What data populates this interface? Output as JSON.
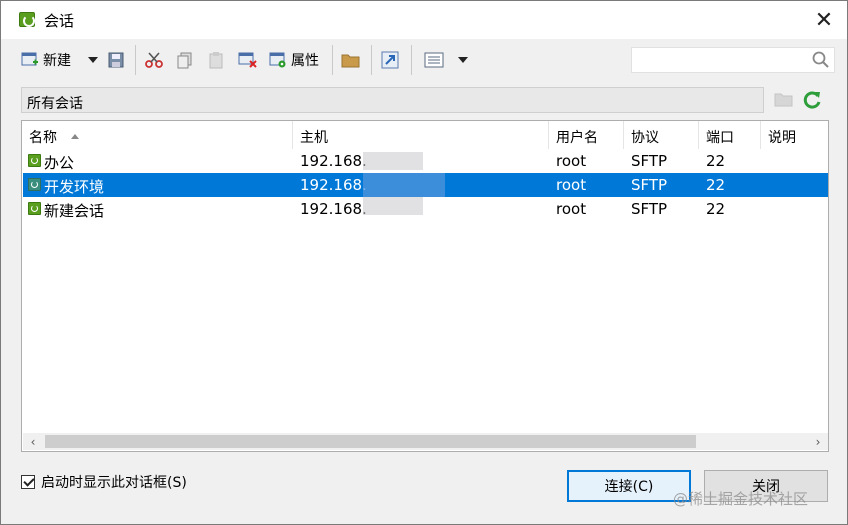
{
  "window": {
    "title": "会话",
    "close_glyph": "✕"
  },
  "toolbar": {
    "new_label": "新建",
    "properties_label": "属性",
    "search_placeholder": ""
  },
  "pathbar": {
    "path": "所有会话"
  },
  "list": {
    "columns": [
      "名称",
      "主机",
      "用户名",
      "协议",
      "端口",
      "说明"
    ],
    "rows": [
      {
        "name": "办公",
        "host": "192.168.",
        "user": "root",
        "protocol": "SFTP",
        "port": "22",
        "selected": false
      },
      {
        "name": "开发环境",
        "host": "192.168.",
        "user": "root",
        "protocol": "SFTP",
        "port": "22",
        "selected": true
      },
      {
        "name": "新建会话",
        "host": "192.168.",
        "user": "root",
        "protocol": "SFTP",
        "port": "22",
        "selected": false
      }
    ]
  },
  "footer": {
    "startup_checkbox_label": "启动时显示此对话框(S)",
    "startup_checked": true,
    "connect_label": "连接(C)",
    "close_label": "关闭"
  },
  "watermark": "@稀土掘金技术社区",
  "colors": {
    "selection": "#0078d7",
    "brand_green": "#5a9e20",
    "refresh_green": "#2e9e3a"
  }
}
